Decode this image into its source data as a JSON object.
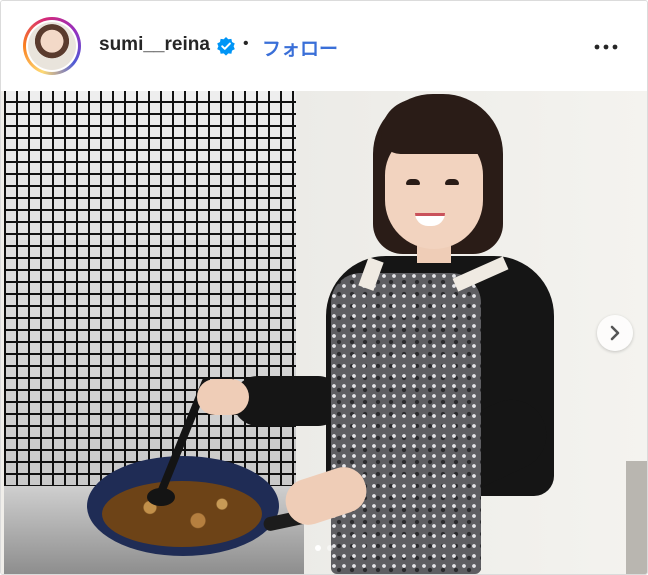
{
  "post_header": {
    "username": "sumi__reina",
    "separator": "•",
    "follow_label": "フォロー",
    "verified_icon": "verified-badge-icon",
    "more_icon": "more-options-icon",
    "accent_color": "#3a6fd8"
  },
  "carousel": {
    "next_icon": "chevron-right-icon",
    "total_slides": 2,
    "active_slide": 1
  }
}
